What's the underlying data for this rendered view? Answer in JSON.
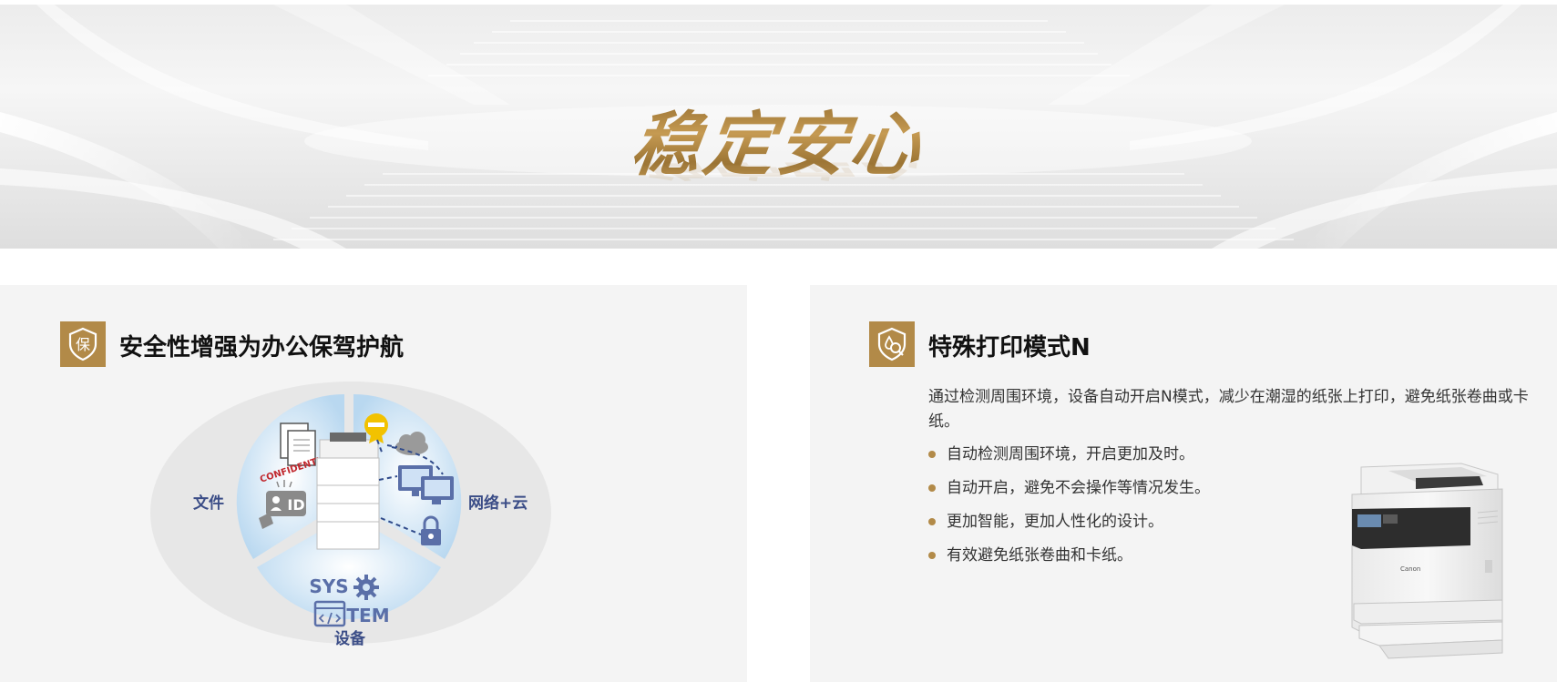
{
  "banner": {
    "title": "稳定安心"
  },
  "left_card": {
    "icon": "shield-icon",
    "icon_text": "保",
    "title": "安全性增强为办公保驾护航",
    "diagram": {
      "label_left": "文件",
      "label_right": "网络+云",
      "label_bottom": "设备",
      "stamp_text": "CONFIDENTIAL",
      "id_text": "ID",
      "sys_text": "SYS",
      "tem_text": "TEM"
    }
  },
  "right_card": {
    "icon": "water-search-icon",
    "title": "特殊打印模式N",
    "description": "通过检测周围环境，设备自动开启N模式，减少在潮湿的纸张上打印，避免纸张卷曲或卡纸。",
    "bullets": [
      "自动检测周围环境，开启更加及时。",
      "自动开启，避免不会操作等情况发生。",
      "更加智能，更加人性化的设计。",
      "有效避免纸张卷曲和卡纸。"
    ],
    "printer_brand": "Canon"
  },
  "colors": {
    "accent_gold": "#b28a48",
    "diagram_blue": "#3b4d87",
    "card_bg": "#f4f4f4"
  }
}
